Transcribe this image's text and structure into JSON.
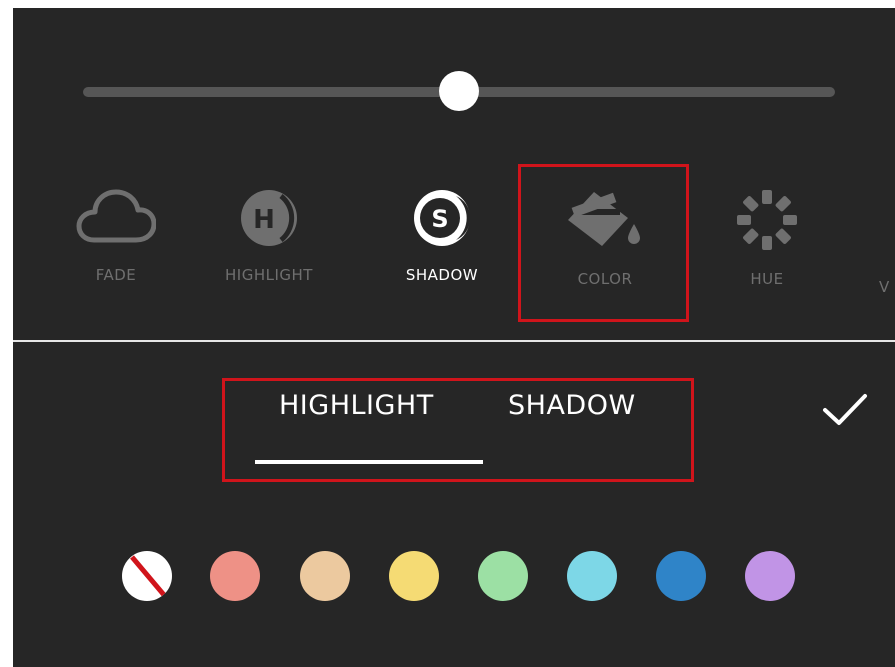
{
  "slider": {
    "value_fraction": 0.5
  },
  "tools": [
    {
      "id": "fade",
      "label": "FADE",
      "icon": "cloud-icon"
    },
    {
      "id": "highlight",
      "label": "HIGHLIGHT",
      "icon": "highlight-h-icon"
    },
    {
      "id": "shadow",
      "label": "SHADOW",
      "icon": "shadow-s-icon",
      "active": true
    },
    {
      "id": "color",
      "label": "COLOR",
      "icon": "paint-bucket-icon"
    },
    {
      "id": "hue",
      "label": "HUE",
      "icon": "hue-wheel-icon"
    }
  ],
  "tabs": {
    "highlight_label": "HIGHLIGHT",
    "shadow_label": "SHADOW",
    "selected": "HIGHLIGHT"
  },
  "confirm_icon": "checkmark-icon",
  "swatches": [
    {
      "name": "none",
      "color": "#ffffff",
      "slash": "#d0141b"
    },
    {
      "name": "red",
      "color": "#ee9186"
    },
    {
      "name": "tan",
      "color": "#ecc99f"
    },
    {
      "name": "yellow",
      "color": "#f5db74"
    },
    {
      "name": "green",
      "color": "#9ce0a4"
    },
    {
      "name": "cyan",
      "color": "#7dd7e7"
    },
    {
      "name": "blue",
      "color": "#2f84c8"
    },
    {
      "name": "purple",
      "color": "#c194e6"
    }
  ],
  "colors": {
    "background": "#262626",
    "highlight_outline": "#d0141b",
    "inactive_text": "#6f6f6f",
    "active_text": "#ffffff"
  }
}
